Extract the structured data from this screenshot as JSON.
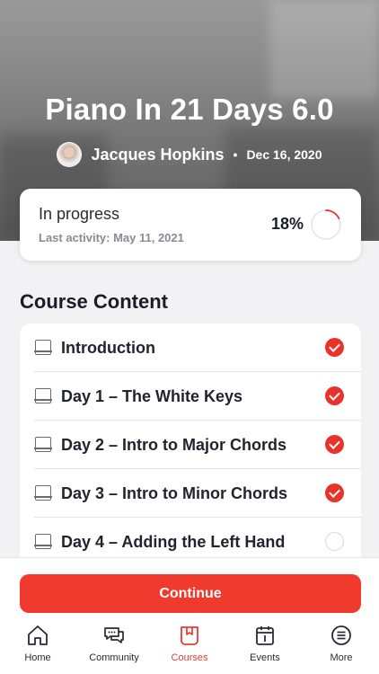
{
  "course": {
    "title": "Piano In 21 Days 6.0",
    "author": "Jacques Hopkins",
    "separator": "•",
    "date": "Dec 16, 2020"
  },
  "progress": {
    "status": "In progress",
    "last_activity": "Last activity: May 11, 2021",
    "percent_label": "18%",
    "fraction": 0.18,
    "accent_color": "#e8322a"
  },
  "section": {
    "title": "Course Content"
  },
  "lessons": [
    {
      "title": "Introduction",
      "completed": true,
      "icon": "book-icon"
    },
    {
      "title": "Day 1 – The White Keys",
      "completed": true,
      "icon": "book-icon"
    },
    {
      "title": "Day 2 – Intro to Major Chords",
      "completed": true,
      "icon": "book-icon"
    },
    {
      "title": "Day 3 – Intro to Minor Chords",
      "completed": true,
      "icon": "book-icon"
    },
    {
      "title": "Day 4 – Adding the Left Hand",
      "completed": false,
      "icon": "book-icon"
    }
  ],
  "actions": {
    "continue_label": "Continue",
    "color": "#ef3a2d"
  },
  "tabs": [
    {
      "label": "Home",
      "icon": "home-icon",
      "active": false
    },
    {
      "label": "Community",
      "icon": "chat-bubbles-icon",
      "active": false
    },
    {
      "label": "Courses",
      "icon": "courses-icon",
      "active": true
    },
    {
      "label": "Events",
      "icon": "calendar-icon",
      "active": false
    },
    {
      "label": "More",
      "icon": "more-menu-icon",
      "active": false
    }
  ]
}
